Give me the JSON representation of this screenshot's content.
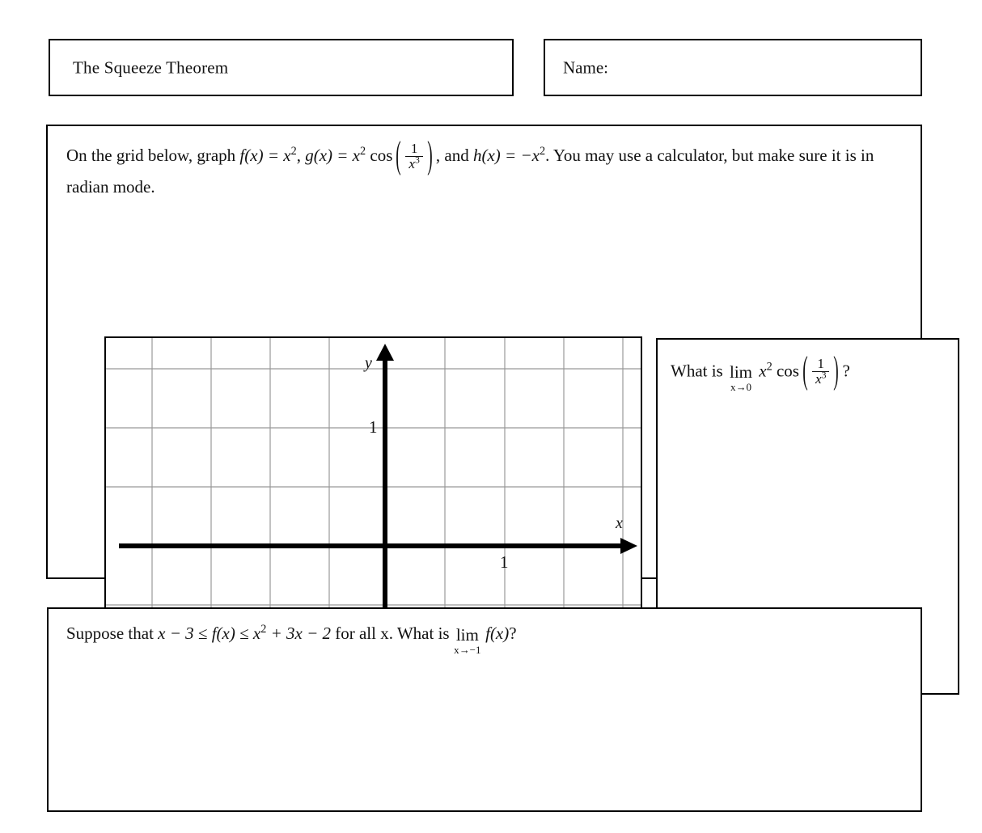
{
  "document": {
    "title": "The Squeeze Theorem",
    "name_label": "Name:"
  },
  "instructions": {
    "part1": "On the grid below, graph ",
    "fx": "f(x) = x",
    "fx_exp": "2",
    "sep1": ", ",
    "gx": "g(x) = x",
    "gx_exp": "2",
    "cos_op": "cos",
    "frac_num": "1",
    "frac_den_var": "x",
    "frac_den_exp": "3",
    "paren_open": "(",
    "paren_close": ")",
    "sep2": ", and ",
    "hx": "h(x) = −x",
    "hx_exp": "2",
    "part2": ". You may use a calculator, but make sure it is in radian mode."
  },
  "limit_question": {
    "lead": "What is ",
    "lim_word": "lim",
    "lim_sub": "x→0",
    "expr_var": "x",
    "expr_exp": "2",
    "cos_op": "cos",
    "paren_open": "(",
    "paren_close": ")",
    "frac_num": "1",
    "frac_den_var": "x",
    "frac_den_exp": "3",
    "trailing": "?"
  },
  "bottom_question": {
    "lead": "Suppose that ",
    "ineq_left": "x − 3 ≤ f(x) ≤ x",
    "ineq_exp": "2",
    "ineq_right": " + 3x − 2",
    "middle": " for all x. What is ",
    "lim_word": "lim",
    "lim_sub": "x→−1",
    "fx": "f(x)",
    "trailing": "?"
  },
  "graph": {
    "x_axis_label": "x",
    "y_axis_label": "y",
    "x_tick_label": "1",
    "y_tick_label": "1",
    "grid_color": "#999999",
    "axis_color": "#000000",
    "border_color": "#000000"
  },
  "chart_data": {
    "type": "line",
    "title": "",
    "xlabel": "x",
    "ylabel": "y",
    "xlim": [
      -4,
      4.25
    ],
    "ylim": [
      -2.5,
      3
    ],
    "grid": true,
    "grid_spacing_x": 1,
    "grid_spacing_y": 1,
    "x_ticks": [
      1
    ],
    "y_ticks": [
      1
    ],
    "x_tick_labels": [
      "1"
    ],
    "y_tick_labels": [
      "1"
    ],
    "legend": "none",
    "series": [],
    "note": "Empty coordinate grid provided for student graphing; no data plotted."
  }
}
